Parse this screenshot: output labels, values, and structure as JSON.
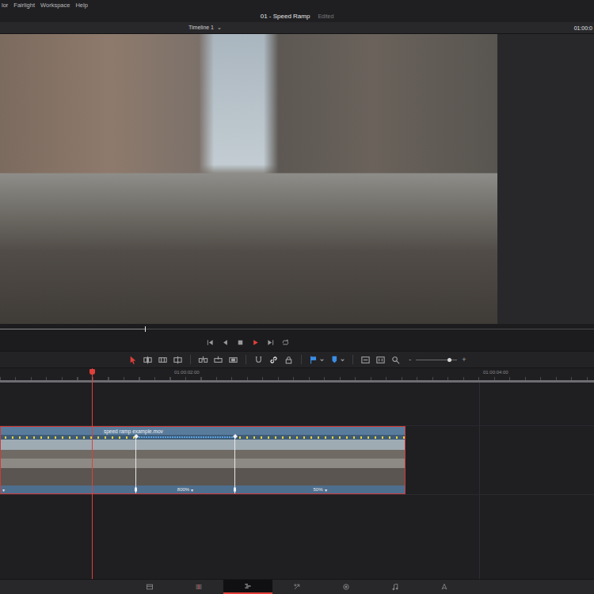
{
  "menu": [
    {
      "label": "lor"
    },
    {
      "label": "Fairlight"
    },
    {
      "label": "Workspace"
    },
    {
      "label": "Help"
    }
  ],
  "project": {
    "title": "01 - Speed Ramp",
    "status": "Edited"
  },
  "timeline_bar": {
    "name": "Timeline 1",
    "dropdown": "⌄",
    "timecode": "01:00:0"
  },
  "viewer": {
    "scrub_level": 0.244
  },
  "transport": [
    {
      "kind": "first",
      "selected": false
    },
    {
      "kind": "reverse",
      "selected": false
    },
    {
      "kind": "stop",
      "selected": false
    },
    {
      "kind": "play",
      "selected": true
    },
    {
      "kind": "last",
      "selected": false
    },
    {
      "kind": "loop",
      "selected": false
    }
  ],
  "tools": [
    {
      "kind": "select",
      "selected": true
    },
    {
      "kind": "trim",
      "selected": false
    },
    {
      "kind": "dynamic",
      "selected": false
    },
    {
      "kind": "blade",
      "selected": false
    },
    {
      "kind": "insert",
      "selected": false
    },
    {
      "kind": "overwrite",
      "selected": false
    },
    {
      "kind": "replace",
      "selected": false
    },
    {
      "kind": "snap",
      "selected": false
    },
    {
      "kind": "link",
      "selected": true
    },
    {
      "kind": "lock",
      "selected": false
    },
    {
      "kind": "flag",
      "selected": false
    },
    {
      "kind": "marker",
      "selected": false
    },
    {
      "kind": "fit",
      "selected": false
    },
    {
      "kind": "detail",
      "selected": false
    },
    {
      "kind": "custom",
      "selected": false
    }
  ],
  "zoom": {
    "minus": "-",
    "plus": "+",
    "level": 0.8
  },
  "ruler": [
    "01:00:02:00",
    "01:00:04:00"
  ],
  "playhead_level": 0.155,
  "clip": {
    "name": "speed ramp example.mov",
    "selected": true,
    "segments": [
      {
        "kind": "normal",
        "dropdown": "▾"
      },
      {
        "kind": "fast",
        "speed": "800%",
        "dropdown": "▾"
      },
      {
        "kind": "slow",
        "speed": "50%",
        "dropdown": "▾"
      }
    ]
  },
  "pages": [
    {
      "kind": "media",
      "selected": false
    },
    {
      "kind": "cut",
      "selected": false
    },
    {
      "kind": "edit",
      "selected": true
    },
    {
      "kind": "fusion",
      "selected": false
    },
    {
      "kind": "color",
      "selected": false
    },
    {
      "kind": "fairlight",
      "selected": false
    },
    {
      "kind": "deliver",
      "selected": false
    }
  ]
}
